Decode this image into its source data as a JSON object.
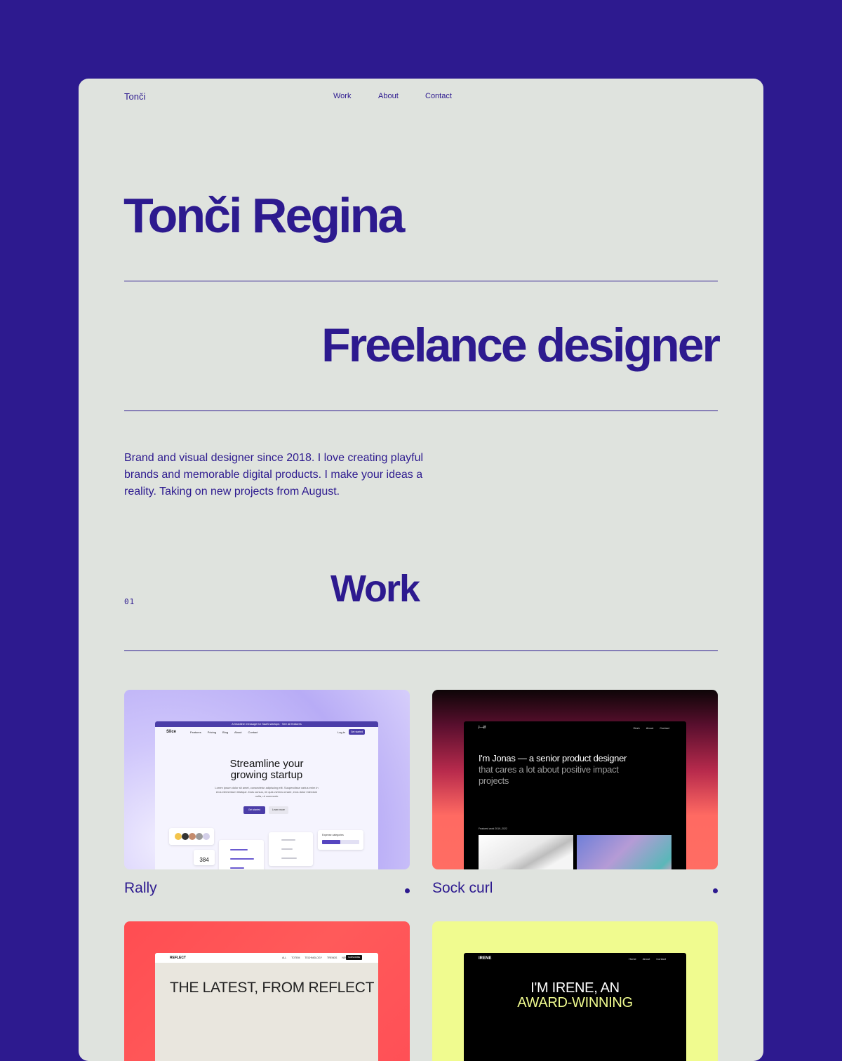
{
  "nav": {
    "logo": "Tonči",
    "links": [
      "Work",
      "About",
      "Contact"
    ]
  },
  "hero": {
    "name": "Tonči Regina",
    "role": "Freelance designer",
    "bio": "Brand and visual designer since 2018. I love creating playful brands and memorable digital products. I make your ideas a reality. Taking on new projects from August."
  },
  "work_section": {
    "number": "01",
    "title": "Work"
  },
  "projects": [
    {
      "title": "Rally",
      "preview": {
        "banner": "A headline message for SaaS startups · See all features",
        "logo": "Slice",
        "links": [
          "Features",
          "Pricing",
          "Blog",
          "About",
          "Contact"
        ],
        "login": "Log in",
        "cta": "Get started",
        "headline_1": "Streamline your",
        "headline_2": "growing startup",
        "sub": "Lorem ipsum dolor sit amet, consectetur adipiscing elit. Suspendisse varius enim in eros elementum tristique. Duis cursus, mi quis viverra ornare, eros dolor interdum nulla, ut commodo",
        "primary": "Get started",
        "secondary": "Learn more",
        "count": "384",
        "card_title": "Expense categories"
      }
    },
    {
      "title": "Sock curl",
      "preview": {
        "logo": "J—Ø",
        "links": [
          "Work",
          "About",
          "Contact"
        ],
        "headline_bold": "I'm Jonas — a senior product designer",
        "headline_muted": " that cares a lot about positive impact projects",
        "featured": "Featured work   2019–2022"
      }
    },
    {
      "title": "",
      "preview": {
        "logo": "REFLECT",
        "links": [
          "ALL",
          "TOTEM",
          "TECHNOLOGY",
          "TRENDS",
          "NEWS"
        ],
        "subscribe": "SUBSCRIBE",
        "headline": "THE LATEST, FROM REFLECT"
      }
    },
    {
      "title": "",
      "preview": {
        "logo": "IRENE",
        "links": [
          "Home",
          "About",
          "Contact"
        ],
        "headline_1": "I'M IRENE, AN",
        "headline_2": "AWARD-WINNING"
      }
    }
  ],
  "colors": {
    "brand": "#2d1a8f",
    "card": "#dfe3de"
  }
}
